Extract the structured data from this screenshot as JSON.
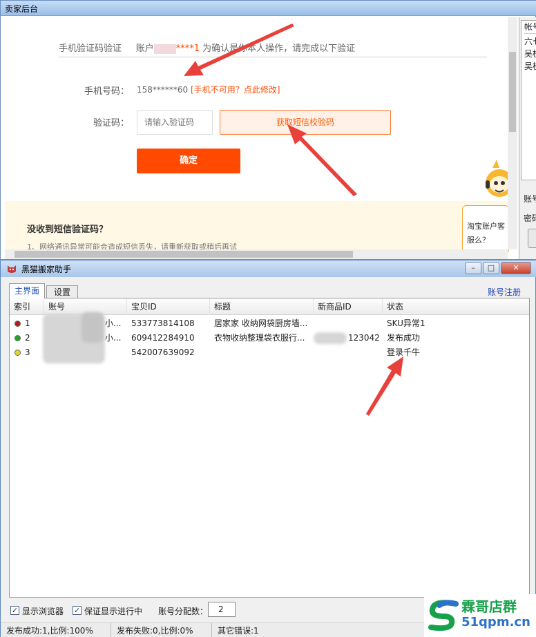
{
  "top_window": {
    "title": "卖家后台",
    "header_label": "手机验证码验证",
    "account_prefix": "账户",
    "account_suffix": "****1",
    "header_note": "为确认是你本人操作，请完成以下验证",
    "phone_label": "手机号码：",
    "phone_value": "158******60",
    "phone_link": "[手机不可用？点此修改]",
    "code_label": "验证码：",
    "code_placeholder": "请输入验证码",
    "sms_button": "获取短信校验码",
    "confirm_button": "确定",
    "help_title": "没收到短信验证码？",
    "help_line": "1、网络通讯异常可能会造成短信丢失，请重新获取或稍后再试",
    "bubble_text": "淘宝账户客服么？"
  },
  "side_panel": {
    "column_header": "帐号",
    "items": [
      "六七",
      "吴桂",
      "吴桂"
    ],
    "account_label": "账号",
    "password_label": "密码"
  },
  "bottom_window": {
    "title": "黑猫搬家助手",
    "window_buttons": {
      "minimize": "–",
      "maximize": "□",
      "close": "✕"
    },
    "tabs": {
      "main": "主界面",
      "settings": "设置"
    },
    "register_link": "账号注册",
    "columns": [
      "索引",
      "账号",
      "宝贝ID",
      "标题",
      "新商品ID",
      "状态"
    ],
    "rows": [
      {
        "index": "1",
        "account": "小...",
        "item_id": "533773814108",
        "title": "居家家 收纳网袋厨房墙...",
        "new_id": "",
        "status": "SKU异常1",
        "dot_color": "#b51c1c"
      },
      {
        "index": "2",
        "account": "小...",
        "item_id": "609412284910",
        "title": "衣物收纳整理袋衣服行...",
        "new_id": "123042",
        "status": "发布成功",
        "dot_color": "#1ea81e"
      },
      {
        "index": "3",
        "account": "001",
        "item_id": "542007639092",
        "title": "",
        "new_id": "",
        "status": "登录千牛",
        "dot_color": "#e8d22c"
      }
    ],
    "show_browser_label": "显示浏览器",
    "ensure_progress_label": "保证显示进行中",
    "alloc_label": "账号分配数：",
    "alloc_value": "2",
    "status": {
      "success": "发布成功:1,比例:100%",
      "failure": "发布失败:0,比例:0%",
      "other": "其它错误:1"
    }
  },
  "watermark": {
    "name": "霖哥店群",
    "url": "51qpm.cn"
  },
  "colors": {
    "accent_orange": "#ff4a00",
    "arrow_red": "#e8413b",
    "link_blue": "#1a3fb8"
  }
}
